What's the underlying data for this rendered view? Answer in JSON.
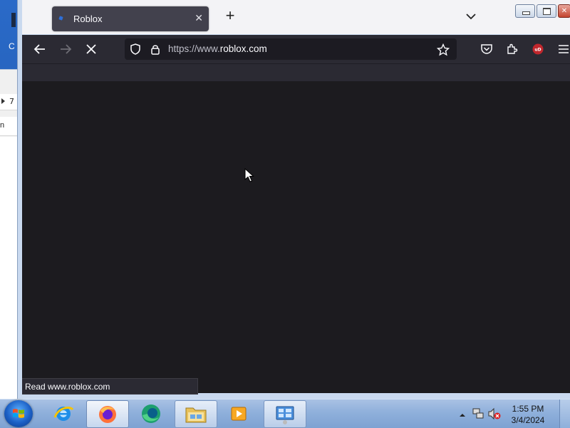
{
  "background_window": {
    "title_fragment": "C",
    "row1_text": "7",
    "row2_text": "n"
  },
  "browser": {
    "tab": {
      "title": "Roblox"
    },
    "url": {
      "display_prefix": "https://www.",
      "display_domain": "roblox.com"
    },
    "status": "Read www.roblox.com"
  },
  "taskbar": {
    "items": [
      {
        "name": "Internet Explorer",
        "icon": "ie-icon"
      },
      {
        "name": "Firefox",
        "icon": "firefox-icon",
        "active": true
      },
      {
        "name": "Edge",
        "icon": "edge-icon"
      },
      {
        "name": "Windows Explorer",
        "icon": "folder-icon"
      },
      {
        "name": "Media Player",
        "icon": "media-player-icon"
      },
      {
        "name": "Control Panel",
        "icon": "control-panel-icon"
      }
    ],
    "clock": {
      "time": "1:55 PM",
      "date": "3/4/2024"
    }
  },
  "colors": {
    "chrome_dark": "#2b2a33",
    "content_bg": "#1c1b1f",
    "tab_active": "#42414d",
    "ublock_red": "#c1272d"
  }
}
